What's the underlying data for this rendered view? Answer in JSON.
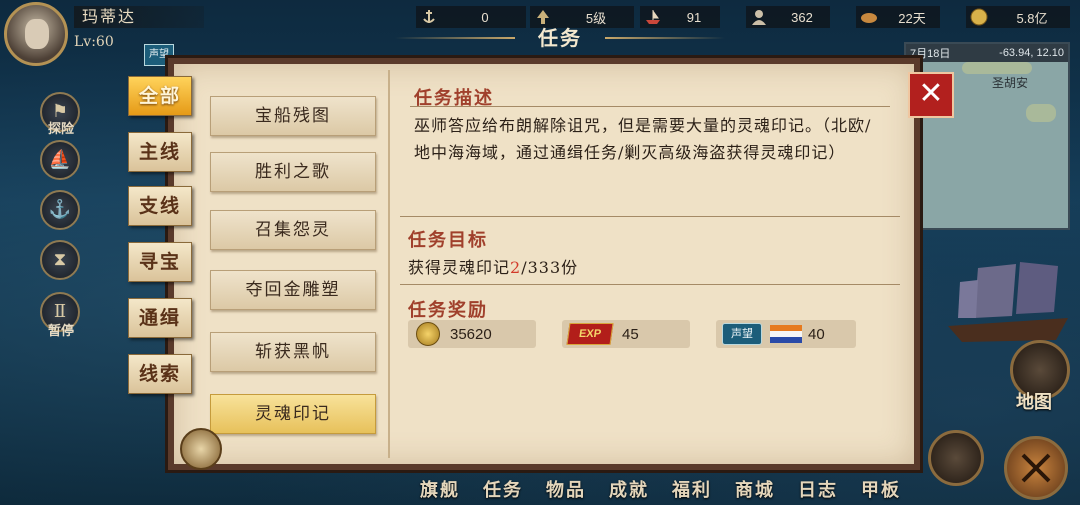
{
  "player": {
    "name": "玛蒂达",
    "level": "Lv:60"
  },
  "stats": [
    {
      "icon": "anchor-icon",
      "value": "0"
    },
    {
      "icon": "level-arrow-icon",
      "value": "5级"
    },
    {
      "icon": "ship-icon",
      "value": "91"
    },
    {
      "icon": "crew-icon",
      "value": "362"
    },
    {
      "icon": "bread-icon",
      "value": "22天"
    },
    {
      "icon": "coin-icon",
      "value": "5.8亿"
    }
  ],
  "window_title": "任务",
  "minimap": {
    "date": "7月18日",
    "coords": "-63.94, 12.10",
    "place": "圣胡安"
  },
  "left_icons": [
    {
      "icon": "explore-flag-icon",
      "label": "探险"
    },
    {
      "icon": "ship-sail-icon",
      "label": ""
    },
    {
      "icon": "anchor-icon",
      "label": ""
    },
    {
      "icon": "hourglass-icon",
      "label": ""
    },
    {
      "icon": "pause-icon",
      "label": "暂停"
    }
  ],
  "badge_label": "声望",
  "categories": [
    {
      "label": "全部",
      "active": true
    },
    {
      "label": "主线",
      "active": false
    },
    {
      "label": "支线",
      "active": false
    },
    {
      "label": "寻宝",
      "active": false
    },
    {
      "label": "通缉",
      "active": false
    },
    {
      "label": "线索",
      "active": false
    }
  ],
  "quests": [
    {
      "label": "宝船残图",
      "selected": false
    },
    {
      "label": "胜利之歌",
      "selected": false
    },
    {
      "label": "召集怨灵",
      "selected": false
    },
    {
      "label": "夺回金雕塑",
      "selected": false
    },
    {
      "label": "斩获黑帆",
      "selected": false
    },
    {
      "label": "灵魂印记",
      "selected": true
    }
  ],
  "detail": {
    "desc_title": "任务描述",
    "desc_text": "巫师答应给布朗解除诅咒，但是需要大量的灵魂印记。（北欧/地中海海域，通过通缉任务/剿灭高级海盗获得灵魂印记）",
    "goal_title": "任务目标",
    "goal_prefix": "获得灵魂印记",
    "goal_current": "2",
    "goal_rest": "/333份",
    "reward_title": "任务奖励",
    "rewards": {
      "coin": "35620",
      "exp_badge": "EXP",
      "exp": "45",
      "rep_badge": "声望",
      "rep": "40"
    }
  },
  "close_symbol": "✕",
  "bottom_nav": [
    "旗舰",
    "任务",
    "物品",
    "成就",
    "福利",
    "商城",
    "日志",
    "甲板"
  ],
  "map_label": "地图",
  "colors": {
    "accent": "#e59a17",
    "title_red": "#a0402c",
    "close": "#b2201e",
    "goal_highlight": "#d23a2a"
  }
}
